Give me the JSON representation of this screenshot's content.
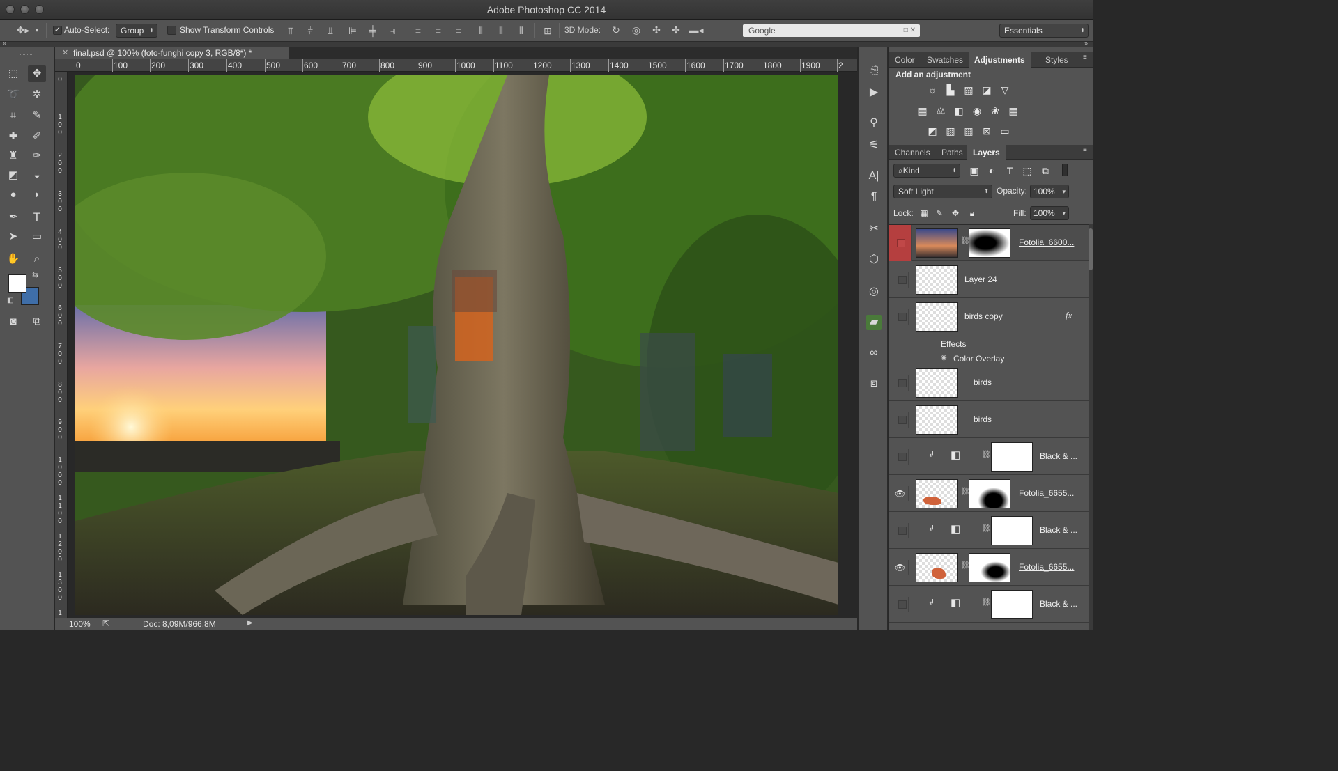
{
  "app": {
    "title": "Adobe Photoshop CC 2014"
  },
  "options": {
    "auto_select_label": "Auto-Select:",
    "auto_select_checked": true,
    "auto_select_value": "Group",
    "show_transform_label": "Show Transform Controls",
    "mode3d_label": "3D Mode:",
    "search_placeholder": "Google",
    "workspace": "Essentials"
  },
  "document": {
    "tab_title": "final.psd @ 100% (foto-funghi copy 3, RGB/8*) *",
    "ruler_h": [
      "0",
      "100",
      "200",
      "300",
      "400",
      "500",
      "600",
      "700",
      "800",
      "900",
      "1000",
      "1100",
      "1200",
      "1300",
      "1400",
      "1500",
      "1600",
      "1700",
      "1800",
      "1900",
      "2"
    ],
    "ruler_v": [
      "0",
      "1\n0\n0",
      "2\n0\n0",
      "3\n0\n0",
      "4\n0\n0",
      "5\n0\n0",
      "6\n0\n0",
      "7\n0\n0",
      "8\n0\n0",
      "9\n0\n0",
      "1\n0\n0\n0",
      "1\n1\n0\n0",
      "1\n2\n0\n0",
      "1\n3\n0\n0",
      "1"
    ],
    "zoom": "100%",
    "doc_info": "Doc: 8,09M/966,8M"
  },
  "adjustments_panel": {
    "tabs": [
      "Color",
      "Swatches",
      "Adjustments",
      "Styles"
    ],
    "active_tab": "Adjustments",
    "heading": "Add an adjustment"
  },
  "layers_panel": {
    "tabs": [
      "Channels",
      "Paths",
      "Layers"
    ],
    "active_tab": "Layers",
    "filter_kind": "Kind",
    "blend_mode": "Soft Light",
    "opacity_label": "Opacity:",
    "opacity": "100%",
    "lock_label": "Lock:",
    "fill_label": "Fill:",
    "fill": "100%",
    "layers": [
      {
        "name": "Fotolia_6600...",
        "visible": false,
        "selected": true
      },
      {
        "name": "Layer 24",
        "visible": false
      },
      {
        "name": "birds copy",
        "visible": false,
        "fx": "fx",
        "effects_label": "Effects",
        "effect": "Color Overlay"
      },
      {
        "name": "birds",
        "visible": false
      },
      {
        "name": "birds",
        "visible": false
      },
      {
        "name": "Black & ...",
        "visible": false
      },
      {
        "name": "Fotolia_6655...",
        "visible": true
      },
      {
        "name": "Black & ...",
        "visible": false
      },
      {
        "name": "Fotolia_6655...",
        "visible": true
      },
      {
        "name": "Black & ...",
        "visible": false
      }
    ]
  },
  "colors": {
    "foreground": "#ffffff",
    "background": "#3f6ea8",
    "selected_layer": "#b53f3f"
  }
}
